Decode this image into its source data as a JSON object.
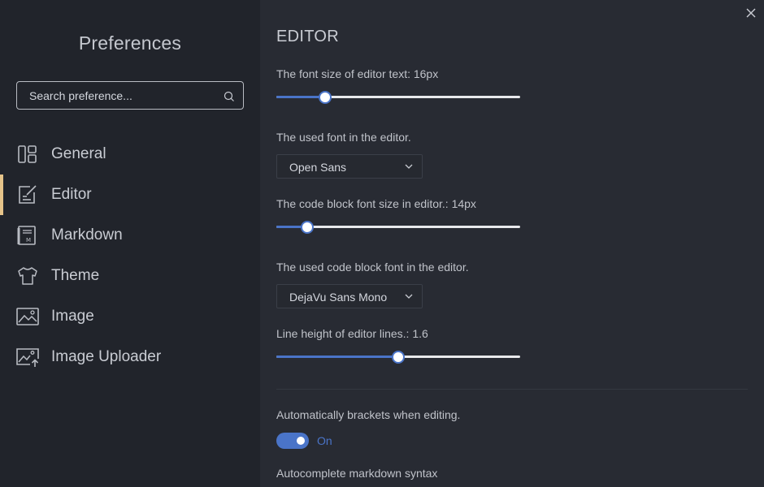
{
  "sidebar": {
    "title": "Preferences",
    "search_placeholder": "Search preference...",
    "items": [
      {
        "label": "General",
        "icon": "general-icon"
      },
      {
        "label": "Editor",
        "icon": "editor-icon"
      },
      {
        "label": "Markdown",
        "icon": "markdown-icon"
      },
      {
        "label": "Theme",
        "icon": "theme-icon"
      },
      {
        "label": "Image",
        "icon": "image-icon"
      },
      {
        "label": "Image Uploader",
        "icon": "image-uploader-icon"
      }
    ],
    "active": "Editor"
  },
  "main": {
    "section_title": "EDITOR",
    "font_size": {
      "label": "The font size of editor text: 16px",
      "value": 16,
      "min": 12,
      "max": 32
    },
    "editor_font": {
      "label": "The used font in the editor.",
      "value": "Open Sans"
    },
    "code_font_size": {
      "label": "The code block font size in editor.: 14px",
      "value": 14,
      "min": 12,
      "max": 28
    },
    "code_font": {
      "label": "The used code block font in the editor.",
      "value": "DejaVu Sans Mono"
    },
    "line_height": {
      "label": "Line height of editor lines.: 1.6",
      "value": 1.6,
      "min": 1.2,
      "max": 2.0
    },
    "auto_brackets": {
      "label": "Automatically brackets when editing.",
      "state": "On"
    },
    "autocomplete": {
      "label": "Autocomplete markdown syntax"
    }
  },
  "colors": {
    "accent": "#4a74c8",
    "active_marker": "#e6c48a",
    "sidebar_bg": "#21242b",
    "main_bg": "#282b33"
  }
}
